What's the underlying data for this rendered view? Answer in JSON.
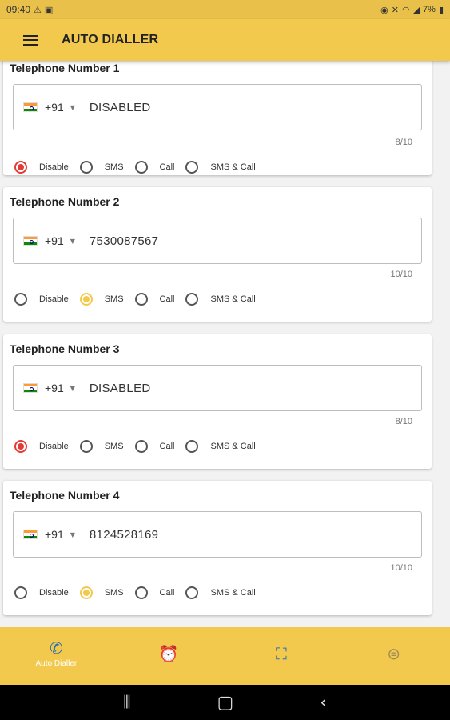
{
  "status_bar": {
    "time": "09:40",
    "left_icons": [
      "warning-icon",
      "alarm-icon"
    ],
    "right_icons": [
      "lock-icon",
      "mute-icon",
      "wifi-icon",
      "signal-icon"
    ],
    "battery": "7%"
  },
  "app_bar": {
    "title": "AUTO DIALLER"
  },
  "cards": [
    {
      "title": "Telephone Number 1",
      "dial_code": "+91",
      "value": "DISABLED",
      "counter": "8/10",
      "selected": "Disable",
      "options": [
        "Disable",
        "SMS",
        "Call",
        "SMS & Call"
      ]
    },
    {
      "title": "Telephone Number 2",
      "dial_code": "+91",
      "value": "7530087567",
      "counter": "10/10",
      "selected": "SMS",
      "options": [
        "Disable",
        "SMS",
        "Call",
        "SMS & Call"
      ]
    },
    {
      "title": "Telephone Number 3",
      "dial_code": "+91",
      "value": "DISABLED",
      "counter": "8/10",
      "selected": "Disable",
      "options": [
        "Disable",
        "SMS",
        "Call",
        "SMS & Call"
      ]
    },
    {
      "title": "Telephone Number 4",
      "dial_code": "+91",
      "value": "8124528169",
      "counter": "10/10",
      "selected": "SMS",
      "options": [
        "Disable",
        "SMS",
        "Call",
        "SMS & Call"
      ]
    }
  ],
  "bottom_nav": {
    "items": [
      {
        "icon": "phone-icon",
        "label": "Auto Dialler",
        "active": true
      },
      {
        "icon": "alarm-clock-icon",
        "label": "",
        "active": false
      },
      {
        "icon": "fullscreen-icon",
        "label": "",
        "active": false
      },
      {
        "icon": "document-icon",
        "label": "",
        "active": false
      }
    ]
  },
  "colors": {
    "accent": "#f2c94c",
    "disable_radio": "#e53935",
    "nav_icon_active": "#2e6fae"
  }
}
